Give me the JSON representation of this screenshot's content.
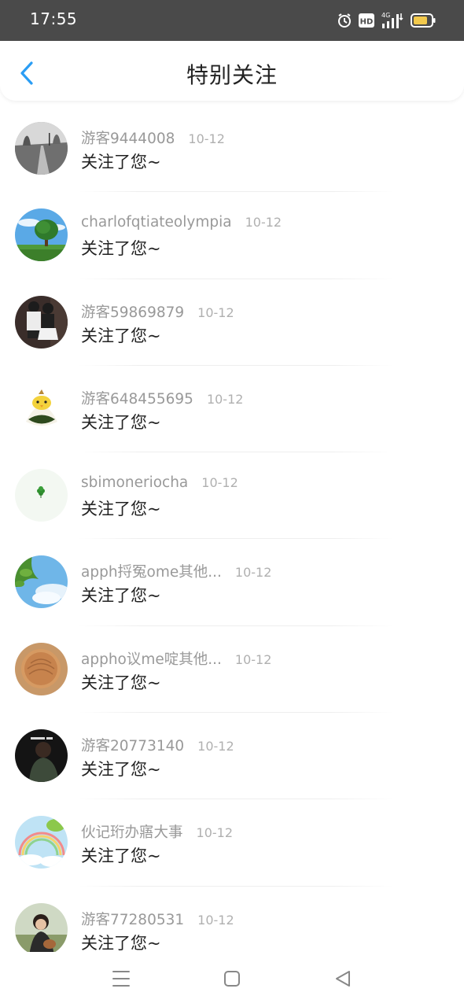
{
  "status_bar": {
    "time": "17:55",
    "network": "4G",
    "hd_badge": "HD",
    "icons": [
      "alarm-icon",
      "hd-icon",
      "signal-icon",
      "battery-icon"
    ]
  },
  "header": {
    "title": "特别关注",
    "back_icon": "chevron-left-icon",
    "accent": "#2a9df4"
  },
  "follows": [
    {
      "name": "游客9444008",
      "date": "10-12",
      "message": "关注了您~"
    },
    {
      "name": "charlofqtiateolympia",
      "date": "10-12",
      "message": "关注了您~"
    },
    {
      "name": "游客59869879",
      "date": "10-12",
      "message": "关注了您~"
    },
    {
      "name": "游客648455695",
      "date": "10-12",
      "message": "关注了您~"
    },
    {
      "name": "sbimoneriocha",
      "date": "10-12",
      "message": "关注了您~"
    },
    {
      "name": "apph捋冤ome其他...",
      "date": "10-12",
      "message": "关注了您~"
    },
    {
      "name": "appho议me啶其他...",
      "date": "10-12",
      "message": "关注了您~"
    },
    {
      "name": "游客20773140",
      "date": "10-12",
      "message": "关注了您~"
    },
    {
      "name": "伙记珩办寤大事",
      "date": "10-12",
      "message": "关注了您~"
    },
    {
      "name": "游客77280531",
      "date": "10-12",
      "message": "关注了您~"
    }
  ],
  "nav_bar": {
    "icons": [
      "menu-icon",
      "home-icon",
      "back-icon"
    ]
  },
  "colors": {
    "status_bar_bg": "#4a4a4a",
    "name_text": "#999999",
    "message_text": "#222222"
  }
}
